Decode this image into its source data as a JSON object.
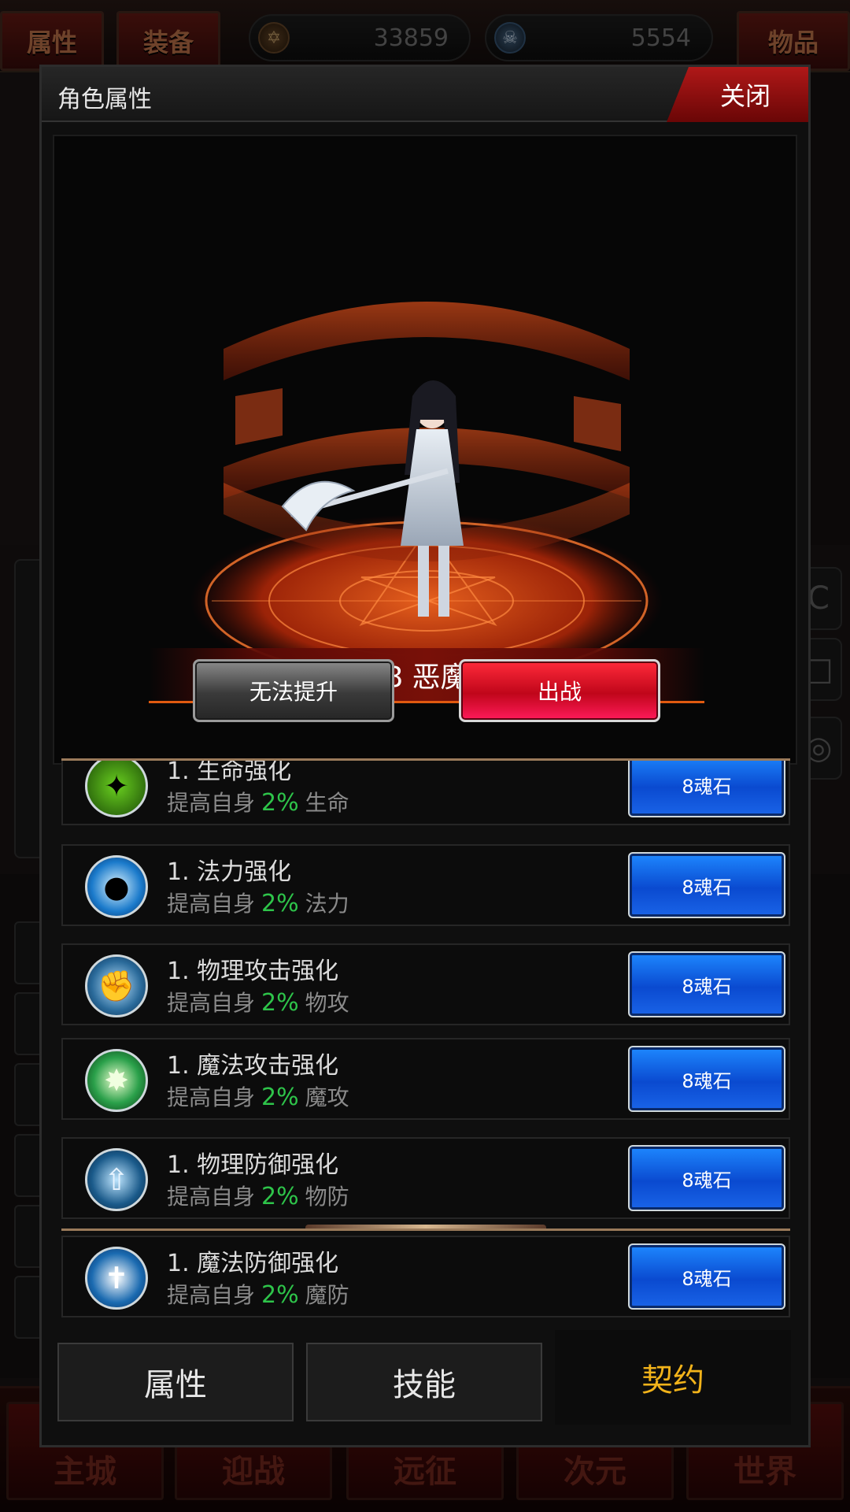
{
  "top_bar": {
    "tab_attributes": "属性",
    "tab_equipment": "装备",
    "soul_amount": "33859",
    "skull_amount": "5554",
    "tab_items": "物品"
  },
  "bottom_nav": [
    "主城",
    "迎战",
    "远征",
    "次元",
    "世界"
  ],
  "dialog": {
    "title": "角色属性",
    "close_label": "关闭",
    "level_line": "Lv.18 恶魔女仆",
    "upgrade_label": "无法提升",
    "deploy_label": "出战"
  },
  "skills": [
    {
      "name": "1. 生命强化",
      "desc_prefix": "提高自身",
      "percent": "2%",
      "stat": "生命",
      "cost": "8魂石",
      "icon": "green-flame-icon",
      "color": "#3a7a1a"
    },
    {
      "name": "1. 法力强化",
      "desc_prefix": "提高自身",
      "percent": "2%",
      "stat": "法力",
      "cost": "8魂石",
      "icon": "blue-orb-icon",
      "color": "#1a7acb"
    },
    {
      "name": "1. 物理攻击强化",
      "desc_prefix": "提高自身",
      "percent": "2%",
      "stat": "物攻",
      "cost": "8魂石",
      "icon": "fist-icon",
      "color": "#2a6a9a"
    },
    {
      "name": "1. 魔法攻击强化",
      "desc_prefix": "提高自身",
      "percent": "2%",
      "stat": "魔攻",
      "cost": "8魂石",
      "icon": "green-burst-icon",
      "color": "#1a8a3a"
    },
    {
      "name": "1. 物理防御强化",
      "desc_prefix": "提高自身",
      "percent": "2%",
      "stat": "物防",
      "cost": "8魂石",
      "icon": "arrow-shield-icon",
      "color": "#1a5a8a"
    },
    {
      "name": "1. 魔法防御强化",
      "desc_prefix": "提高自身",
      "percent": "2%",
      "stat": "魔防",
      "cost": "8魂石",
      "icon": "cross-shield-icon",
      "color": "#1a6ab0"
    }
  ],
  "tabs": {
    "attributes": "属性",
    "skills": "技能",
    "contract": "契约"
  },
  "colors": {
    "accent_gold": "#f2b31a",
    "percent_green": "#2ec44a",
    "close_red": "#b01818"
  }
}
